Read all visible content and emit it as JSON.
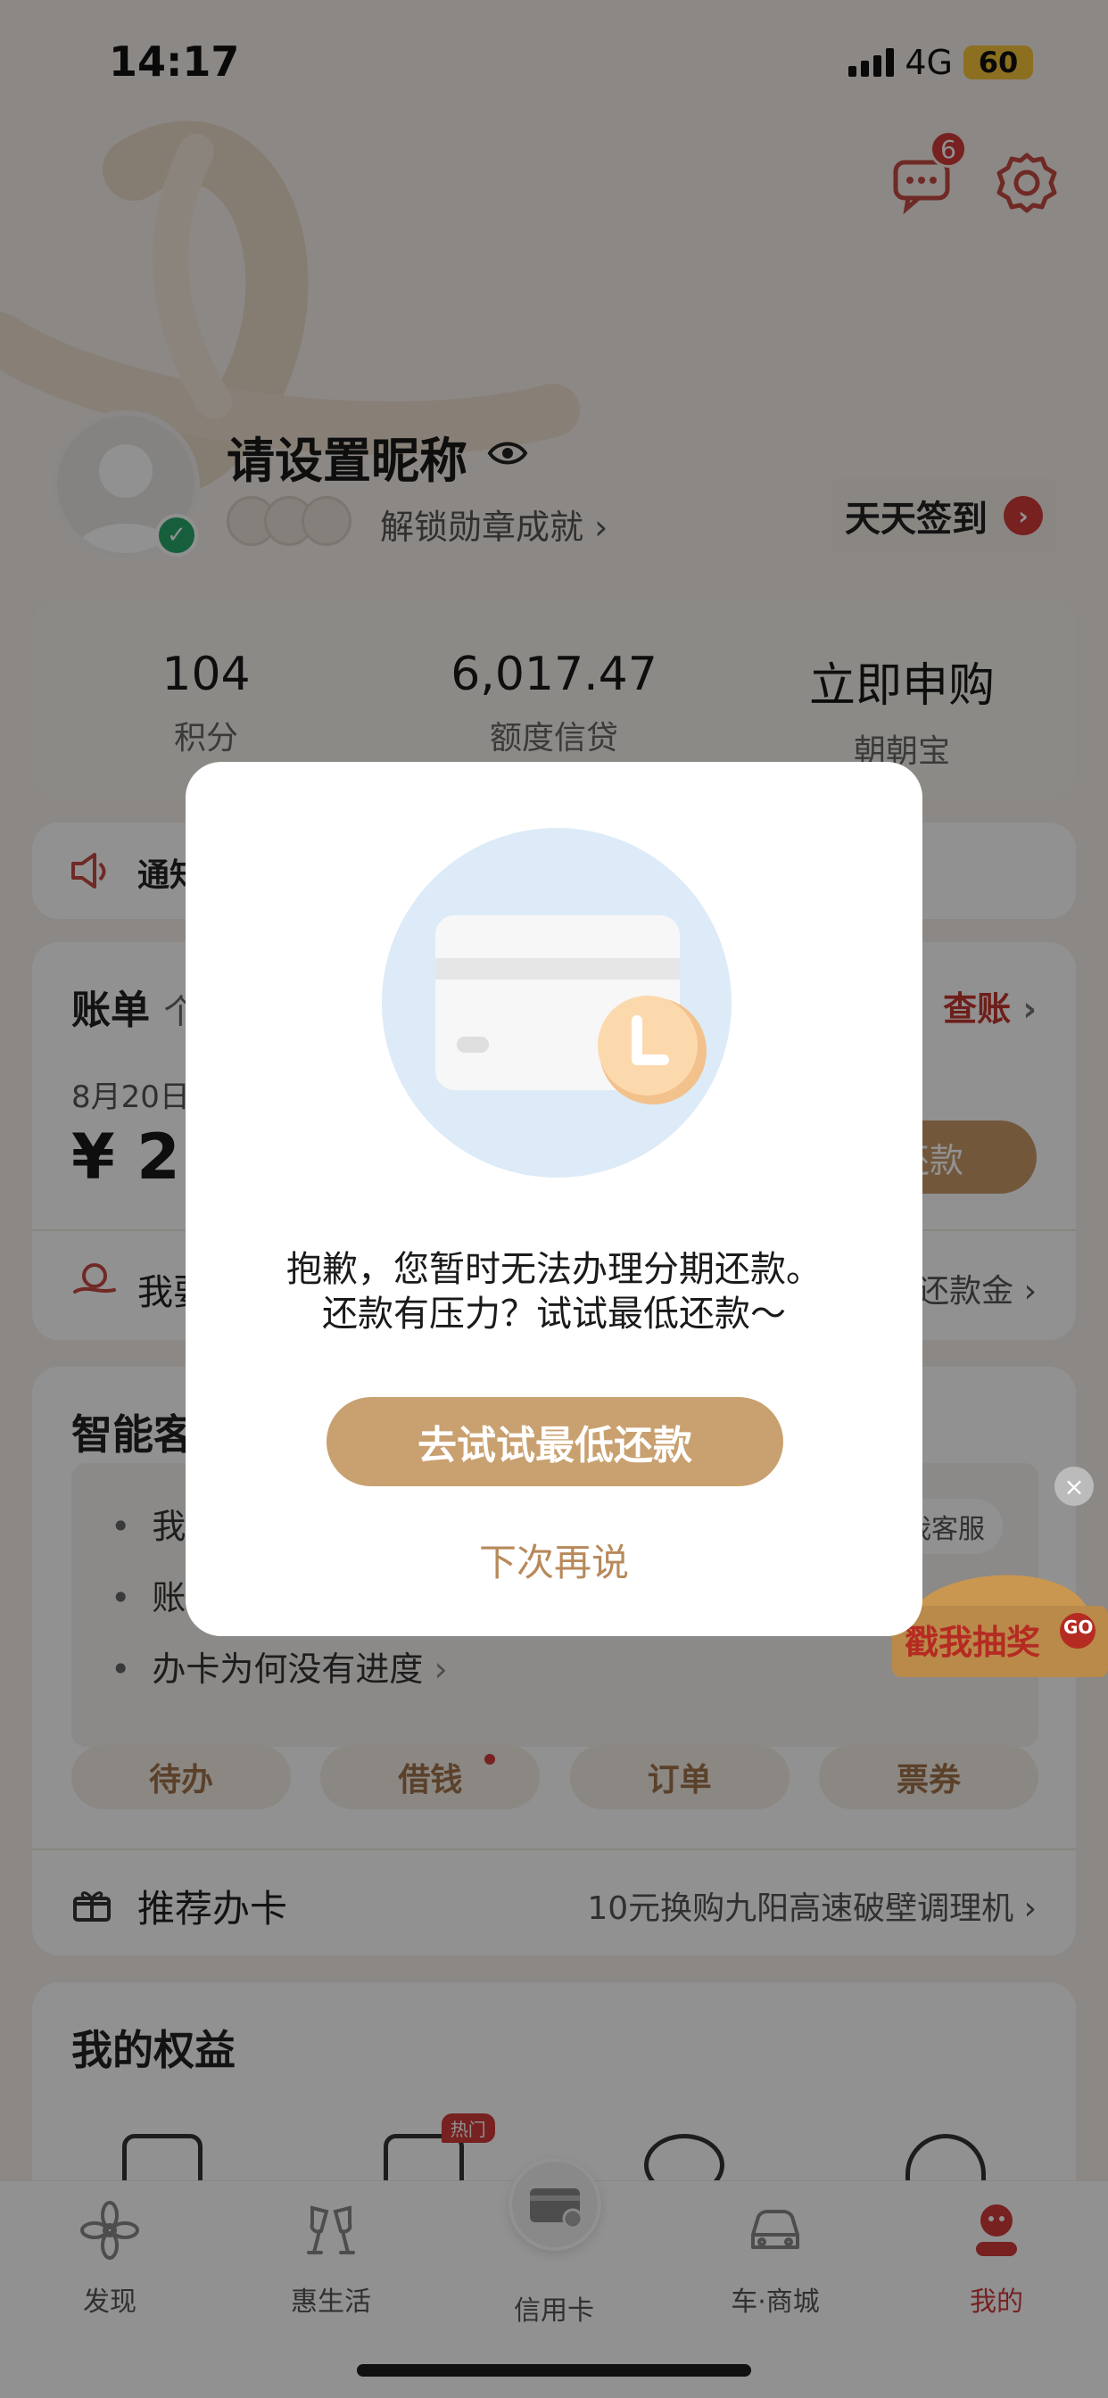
{
  "status_bar": {
    "time": "14:17",
    "network": "4G",
    "battery": "60"
  },
  "header": {
    "message_badge": "6"
  },
  "profile": {
    "nickname": "请设置昵称",
    "medal_text": "解锁勋章成就",
    "sign_in_label": "天天签到"
  },
  "stats": [
    {
      "value": "104",
      "label": "积分"
    },
    {
      "value": "6,017.47",
      "label": "额度信贷"
    },
    {
      "value": "立即申购",
      "label": "朝朝宝"
    }
  ],
  "notice": {
    "label": "通知"
  },
  "bill": {
    "title": "账单",
    "title_suffix": "个",
    "check_label": "查账",
    "date": "8月20日",
    "amount": "¥ 21",
    "pay_label": "还款",
    "row_left": "我要",
    "row_right": "还款金"
  },
  "service": {
    "title": "智能客",
    "faq": [
      "我的",
      "账单",
      "办卡为何没有进度"
    ],
    "kefu_tag": "我客服",
    "quick_actions": [
      "待办",
      "借钱",
      "订单",
      "票券"
    ],
    "recommend_label": "推荐办卡",
    "recommend_desc": "10元换购九阳高速破壁调理机"
  },
  "rights": {
    "title": "我的权益",
    "hot_tag": "热门"
  },
  "floating_promo": {
    "text": "戳我抽奖",
    "go": "GO"
  },
  "tabbar": [
    {
      "label": "发现",
      "icon": "flower-icon"
    },
    {
      "label": "惠生活",
      "icon": "cheers-icon"
    },
    {
      "label": "信用卡",
      "icon": "card-icon"
    },
    {
      "label": "车·商城",
      "icon": "car-icon"
    },
    {
      "label": "我的",
      "icon": "profile-icon"
    }
  ],
  "modal": {
    "line1": "抱歉，您暂时无法办理分期还款。",
    "line2": "还款有压力？试试最低还款～",
    "primary_label": "去试试最低还款",
    "secondary_label": "下次再说"
  },
  "colors": {
    "accent": "#c9a06f",
    "brand_red": "#d23b3b",
    "link_gold": "#b8895b"
  }
}
